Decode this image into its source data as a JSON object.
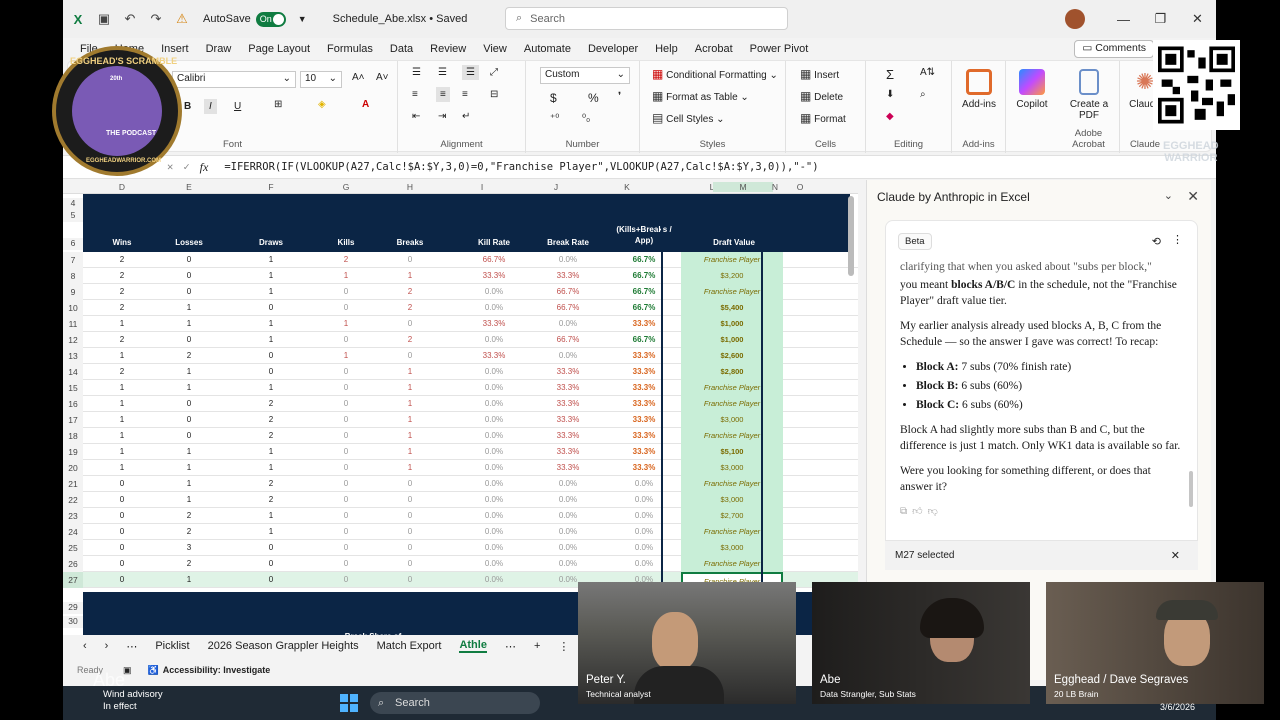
{
  "titlebar": {
    "autosave_label": "AutoSave",
    "autosave_state": "On",
    "filename": "Schedule_Abe.xlsx • Saved",
    "search_placeholder": "Search"
  },
  "menu": [
    "File",
    "Home",
    "Insert",
    "Draw",
    "Page Layout",
    "Formulas",
    "Data",
    "Review",
    "View",
    "Automate",
    "Developer",
    "Help",
    "Acrobat",
    "Power Pivot"
  ],
  "comments_label": "Comments",
  "ribbon": {
    "font_name": "Calibri",
    "font_size": "10",
    "font_label": "Font",
    "alignment_label": "Alignment",
    "number_format": "Custom",
    "number_label": "Number",
    "conditional_formatting": "Conditional Formatting",
    "format_as_table": "Format as Table",
    "cell_styles": "Cell Styles",
    "styles_label": "Styles",
    "insert": "Insert",
    "delete": "Delete",
    "format": "Format",
    "cells_label": "Cells",
    "editing_label": "Editing",
    "addins": "Add-ins",
    "addins_label": "Add-ins",
    "copilot": "Copilot",
    "create_pdf": "Create a PDF",
    "adobe_label": "Adobe Acrobat",
    "claude": "Claude",
    "claude_label": "Claude"
  },
  "formula_bar": {
    "fx": "fx",
    "formula": "=IFERROR(IF(VLOOKUP(A27,Calc!$A:$Y,3,0)=0,\"Franchise Player\",VLOOKUP(A27,Calc!$A:$Y,3,0)),\"-\")"
  },
  "grid": {
    "column_letters": [
      "D",
      "E",
      "F",
      "G",
      "H",
      "I",
      "J",
      "K",
      "L",
      "M",
      "N",
      "O"
    ],
    "headers": [
      "Wins",
      "Losses",
      "Draws",
      "Kills",
      "Breaks",
      "Kill Rate",
      "Break Rate",
      "(Kills+Breaks / App)",
      "Draft Value"
    ],
    "top_rows": [
      "4",
      "5",
      "6"
    ],
    "rows": [
      {
        "r": "7",
        "w": "2",
        "l": "0",
        "d": "1",
        "k": "2",
        "b": "0",
        "kr": "66.7%",
        "br": "0.0%",
        "kb": "66.7%",
        "dv": "Franchise Player"
      },
      {
        "r": "8",
        "w": "2",
        "l": "0",
        "d": "1",
        "k": "1",
        "b": "1",
        "kr": "33.3%",
        "br": "33.3%",
        "kb": "66.7%",
        "dv": "$3,200"
      },
      {
        "r": "9",
        "w": "2",
        "l": "0",
        "d": "1",
        "k": "0",
        "b": "2",
        "kr": "0.0%",
        "br": "66.7%",
        "kb": "66.7%",
        "dv": "Franchise Player"
      },
      {
        "r": "10",
        "w": "2",
        "l": "1",
        "d": "0",
        "k": "0",
        "b": "2",
        "kr": "0.0%",
        "br": "66.7%",
        "kb": "66.7%",
        "dv": "$5,400"
      },
      {
        "r": "11",
        "w": "1",
        "l": "1",
        "d": "1",
        "k": "1",
        "b": "0",
        "kr": "33.3%",
        "br": "0.0%",
        "kb": "33.3%",
        "dv": "$1,000"
      },
      {
        "r": "12",
        "w": "2",
        "l": "0",
        "d": "1",
        "k": "0",
        "b": "2",
        "kr": "0.0%",
        "br": "66.7%",
        "kb": "66.7%",
        "dv": "$1,000"
      },
      {
        "r": "13",
        "w": "1",
        "l": "2",
        "d": "0",
        "k": "1",
        "b": "0",
        "kr": "33.3%",
        "br": "0.0%",
        "kb": "33.3%",
        "dv": "$2,600"
      },
      {
        "r": "14",
        "w": "2",
        "l": "1",
        "d": "0",
        "k": "0",
        "b": "1",
        "kr": "0.0%",
        "br": "33.3%",
        "kb": "33.3%",
        "dv": "$2,800"
      },
      {
        "r": "15",
        "w": "1",
        "l": "1",
        "d": "1",
        "k": "0",
        "b": "1",
        "kr": "0.0%",
        "br": "33.3%",
        "kb": "33.3%",
        "dv": "Franchise Player"
      },
      {
        "r": "16",
        "w": "1",
        "l": "0",
        "d": "2",
        "k": "0",
        "b": "1",
        "kr": "0.0%",
        "br": "33.3%",
        "kb": "33.3%",
        "dv": "Franchise Player"
      },
      {
        "r": "17",
        "w": "1",
        "l": "0",
        "d": "2",
        "k": "0",
        "b": "1",
        "kr": "0.0%",
        "br": "33.3%",
        "kb": "33.3%",
        "dv": "$3,000"
      },
      {
        "r": "18",
        "w": "1",
        "l": "0",
        "d": "2",
        "k": "0",
        "b": "1",
        "kr": "0.0%",
        "br": "33.3%",
        "kb": "33.3%",
        "dv": "Franchise Player"
      },
      {
        "r": "19",
        "w": "1",
        "l": "1",
        "d": "1",
        "k": "0",
        "b": "1",
        "kr": "0.0%",
        "br": "33.3%",
        "kb": "33.3%",
        "dv": "$5,100"
      },
      {
        "r": "20",
        "w": "1",
        "l": "1",
        "d": "1",
        "k": "0",
        "b": "1",
        "kr": "0.0%",
        "br": "33.3%",
        "kb": "33.3%",
        "dv": "$3,000"
      },
      {
        "r": "21",
        "w": "0",
        "l": "1",
        "d": "2",
        "k": "0",
        "b": "0",
        "kr": "0.0%",
        "br": "0.0%",
        "kb": "0.0%",
        "dv": "Franchise Player"
      },
      {
        "r": "22",
        "w": "0",
        "l": "1",
        "d": "2",
        "k": "0",
        "b": "0",
        "kr": "0.0%",
        "br": "0.0%",
        "kb": "0.0%",
        "dv": "$3,000"
      },
      {
        "r": "23",
        "w": "0",
        "l": "2",
        "d": "1",
        "k": "0",
        "b": "0",
        "kr": "0.0%",
        "br": "0.0%",
        "kb": "0.0%",
        "dv": "$2,700"
      },
      {
        "r": "24",
        "w": "0",
        "l": "2",
        "d": "1",
        "k": "0",
        "b": "0",
        "kr": "0.0%",
        "br": "0.0%",
        "kb": "0.0%",
        "dv": "Franchise Player"
      },
      {
        "r": "25",
        "w": "0",
        "l": "3",
        "d": "0",
        "k": "0",
        "b": "0",
        "kr": "0.0%",
        "br": "0.0%",
        "kb": "0.0%",
        "dv": "$3,000"
      },
      {
        "r": "26",
        "w": "0",
        "l": "2",
        "d": "0",
        "k": "0",
        "b": "0",
        "kr": "0.0%",
        "br": "0.0%",
        "kb": "0.0%",
        "dv": "Franchise Player"
      },
      {
        "r": "27",
        "w": "0",
        "l": "1",
        "d": "0",
        "k": "0",
        "b": "0",
        "kr": "0.0%",
        "br": "0.0%",
        "kb": "0.0%",
        "dv": "Franchise Player"
      }
    ],
    "bottom_rows": [
      "29",
      "30"
    ],
    "bottom_label": "Break Share of"
  },
  "sheet_tabs": [
    "Picklist",
    "2026 Season Grappler Heights",
    "Match Export",
    "Athle"
  ],
  "status": {
    "ready": "Ready",
    "accessibility": "Accessibility: Investigate"
  },
  "pane": {
    "title": "Claude by Anthropic in Excel",
    "beta": "Beta",
    "intro_line": "clarifying that when you asked about \"subs per block,\"",
    "p1_pre": "you meant ",
    "p1_bold": "blocks A/B/C",
    "p1_post": " in the schedule, not the \"Franchise Player\" draft value tier.",
    "p2": "My earlier analysis already used blocks A, B, C from the Schedule — so the answer I gave was correct! To recap:",
    "bullets": [
      {
        "label": "Block A:",
        "text": " 7 subs (70% finish rate)"
      },
      {
        "label": "Block B:",
        "text": " 6 subs (60%)"
      },
      {
        "label": "Block C:",
        "text": " 6 subs (60%)"
      }
    ],
    "p3": "Block A had slightly more subs than B and C, but the difference is just 1 match. Only WK1 data is available so far.",
    "p4": "Were you looking for something different, or does that answer it?",
    "selection": "M27 selected"
  },
  "videos": [
    {
      "name": "Peter Y.",
      "role": "Technical analyst"
    },
    {
      "name": "Abe",
      "role": "Data Strangler, Sub Stats"
    },
    {
      "name": "Egghead / Dave Segraves",
      "role": "20 LB Brain"
    }
  ],
  "logo": {
    "line1": "EGGHEAD'S SCRAMBLE",
    "line2": "THE PODCAST",
    "line3": "EGGHEADWARRIOR.COM",
    "badge": "20th"
  },
  "qr_watermark": [
    "EGGHEAD",
    "WARRIOR"
  ],
  "abe_watermark": "Abe",
  "taskbar": {
    "weather_title": "Wind advisory",
    "weather_sub": "In effect",
    "search": "Search",
    "date": "3/6/2026"
  }
}
